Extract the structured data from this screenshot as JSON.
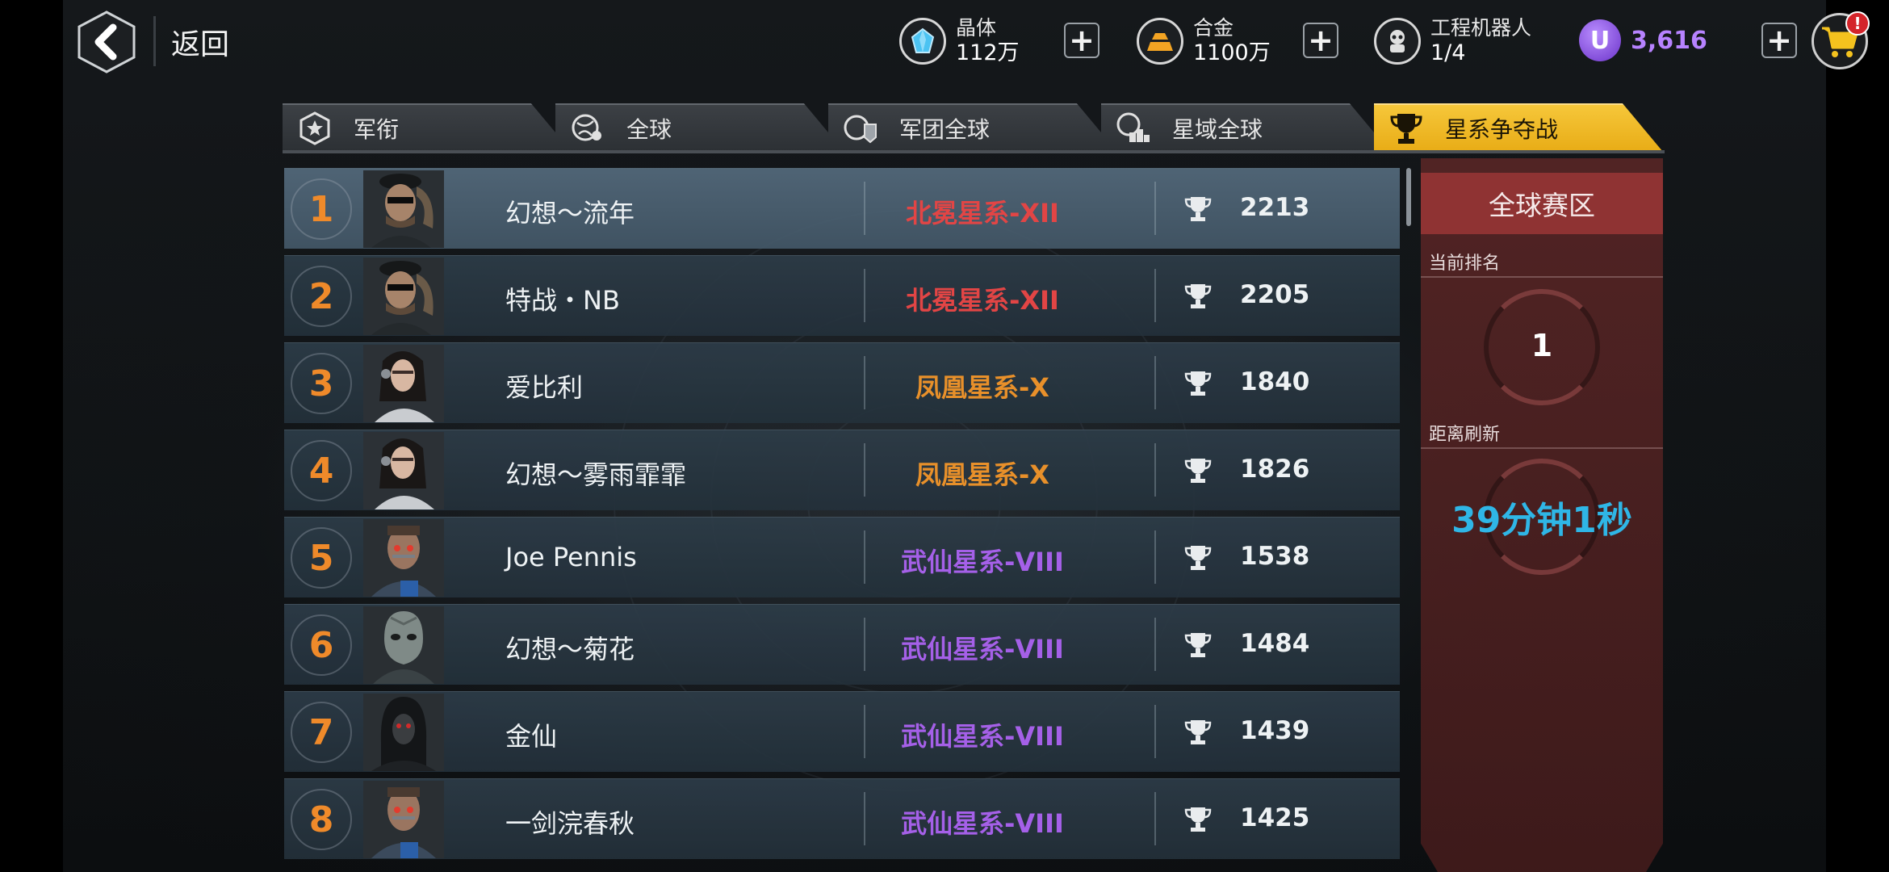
{
  "header": {
    "back_label": "返回"
  },
  "resources": [
    {
      "name": "晶体",
      "value": "112万",
      "icon": "crystal-icon"
    },
    {
      "name": "合金",
      "value": "1100万",
      "icon": "alloy-icon"
    },
    {
      "name": "工程机器人",
      "value": "1/4",
      "icon": "robot-icon"
    }
  ],
  "currency": {
    "symbol": "U",
    "value": "3,616",
    "color": "#b783ff"
  },
  "cart": {
    "badge": "!"
  },
  "tabs": [
    {
      "label": "军衔",
      "icon": "rank-badge-icon",
      "active": false
    },
    {
      "label": "全球",
      "icon": "globe-icon",
      "active": false
    },
    {
      "label": "军团全球",
      "icon": "legion-globe-icon",
      "active": false
    },
    {
      "label": "星域全球",
      "icon": "podium-icon",
      "active": false
    },
    {
      "label": "星系争夺战",
      "icon": "trophy-icon",
      "active": true
    }
  ],
  "leaderboard": [
    {
      "rank": "1",
      "name": "幻想～流年",
      "galaxy": "北冕星系-XII",
      "galaxy_color": "#e24545",
      "score": "2213",
      "avatar": "officer"
    },
    {
      "rank": "2",
      "name": "特战・NB",
      "galaxy": "北冕星系-XII",
      "galaxy_color": "#e24545",
      "score": "2205",
      "avatar": "officer"
    },
    {
      "rank": "3",
      "name": "爱比利",
      "galaxy": "凤凰星系-X",
      "galaxy_color": "#e8902a",
      "score": "1840",
      "avatar": "woman"
    },
    {
      "rank": "4",
      "name": "幻想～雾雨霏霏",
      "galaxy": "凤凰星系-X",
      "galaxy_color": "#e8902a",
      "score": "1826",
      "avatar": "woman"
    },
    {
      "rank": "5",
      "name": "Joe Pennis",
      "galaxy": "武仙星系-VIII",
      "galaxy_color": "#a560e8",
      "score": "1538",
      "avatar": "cyborg"
    },
    {
      "rank": "6",
      "name": "幻想～菊花",
      "galaxy": "武仙星系-VIII",
      "galaxy_color": "#a560e8",
      "score": "1484",
      "avatar": "alien"
    },
    {
      "rank": "7",
      "name": "金仙",
      "galaxy": "武仙星系-VIII",
      "galaxy_color": "#a560e8",
      "score": "1439",
      "avatar": "hooded"
    },
    {
      "rank": "8",
      "name": "一剑浣春秋",
      "galaxy": "武仙星系-VIII",
      "galaxy_color": "#a560e8",
      "score": "1425",
      "avatar": "cyborg"
    }
  ],
  "side_panel": {
    "title": "全球赛区",
    "current_rank_label": "当前排名",
    "current_rank": "1",
    "refresh_label": "距离刷新",
    "refresh_value": "39分钟1秒"
  }
}
